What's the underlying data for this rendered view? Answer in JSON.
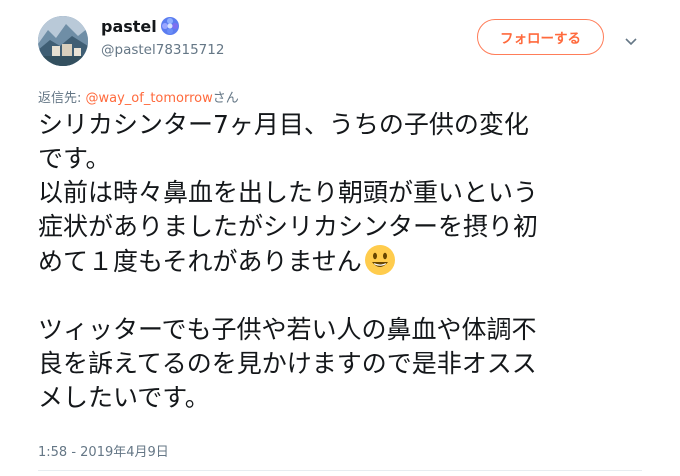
{
  "user": {
    "display_name": "pastel",
    "handle": "@pastel78315712",
    "badge_icon": "blue-gem-icon"
  },
  "follow_button": {
    "label": "フォローする",
    "color": "#ff6a3d"
  },
  "menu": {
    "icon": "chevron-down-icon"
  },
  "reply": {
    "prefix": "返信先: ",
    "target": "@way_of_tomorrow",
    "suffix": "さん"
  },
  "tweet": {
    "lines1": [
      "シリカシンター7ヶ月目、うちの子供の変化",
      "です。",
      "以前は時々鼻血を出したり朝頭が重いという",
      "症状がありましたがシリカシンターを摂り初",
      "めて１度もそれがありません"
    ],
    "emoji": "smiling-face-emoji",
    "lines2": [
      "ツィッターでも子供や若い人の鼻血や体調不",
      "良を訴えてるのを見かけますので是非オスス",
      "メしたいです。"
    ]
  },
  "timestamp": "1:58 - 2019年4月9日"
}
